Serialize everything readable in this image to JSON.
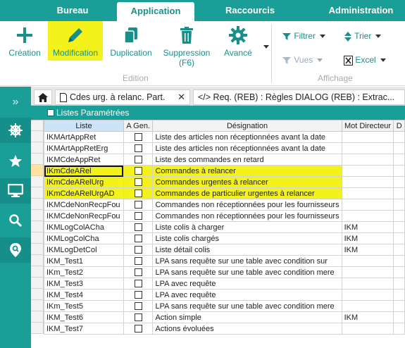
{
  "menu": {
    "tabs": [
      "Bureau",
      "Application",
      "Raccourcis",
      "Administration"
    ],
    "active": "Application"
  },
  "ribbon": {
    "creation": "Création",
    "modification": "Modification",
    "duplication": "Duplication",
    "suppression": "Suppression",
    "suppression_key": "(F6)",
    "avance": "Avancé",
    "group_edition": "Edition",
    "filtrer": "Filtrer",
    "trier": "Trier",
    "vues": "Vues",
    "excel": "Excel",
    "group_affichage": "Affichage"
  },
  "doc_tabs": {
    "tab1": "Cdes urg. à relanc. Part.",
    "tab2": "</> Req. (REB) : Règles DIALOG (REB) : Extrac..."
  },
  "panel": {
    "title": "Listes Paramétrées"
  },
  "grid": {
    "headers": [
      "Liste",
      "A Gen.",
      "Désignation",
      "Mot Directeur",
      "D"
    ],
    "rows": [
      {
        "liste": "IKMArtAppRet",
        "designation": "Liste des articles non réceptionnées avant la date",
        "mot": ""
      },
      {
        "liste": "IKMArtAppRetErg",
        "designation": "Liste des articles non réceptionnées avant la date",
        "mot": ""
      },
      {
        "liste": "IKMCdeAppRet",
        "designation": "Liste des commandes en retard",
        "mot": ""
      },
      {
        "liste": "IKmCdeARel",
        "designation": "Commandes à relancer",
        "mot": ""
      },
      {
        "liste": "IKmCdeARelUrg",
        "designation": "Commandes urgentes à relancer",
        "mot": ""
      },
      {
        "liste": "IKmCdeARelUrgAD",
        "designation": "Commandes de particulier urgentes à relancer",
        "mot": ""
      },
      {
        "liste": "IKMCdeNonRecpFou",
        "designation": "Commandes non réceptionnées pour les fournisseurs",
        "mot": ""
      },
      {
        "liste": "IKMCdeNonRecpFou",
        "designation": "Commandes non réceptionnées pour les fournisseurs",
        "mot": ""
      },
      {
        "liste": "IKMLogColACha",
        "designation": "Liste colis à charger",
        "mot": "IKM"
      },
      {
        "liste": "IKMLogColCha",
        "designation": "Liste colis chargés",
        "mot": "IKM"
      },
      {
        "liste": "IKMLogDetCol",
        "designation": "Liste détail colis",
        "mot": "IKM"
      },
      {
        "liste": "IKM_Test1",
        "designation": "LPA sans requête sur une table avec condition sur",
        "mot": ""
      },
      {
        "liste": "IKm_Test2",
        "designation": "LPA sans requête sur une table avec condition mere",
        "mot": ""
      },
      {
        "liste": "IKM_Test3",
        "designation": "LPA avec requête",
        "mot": ""
      },
      {
        "liste": "IKM_Test4",
        "designation": "LPA avec requête",
        "mot": ""
      },
      {
        "liste": "IKm_Test5",
        "designation": "LPA sans requête sur une table avec condition mere",
        "mot": ""
      },
      {
        "liste": "IKM_Test6",
        "designation": "Action simple",
        "mot": "IKM"
      },
      {
        "liste": "IKM_Test7",
        "designation": "Actions évoluées",
        "mot": ""
      }
    ]
  },
  "colors": {
    "teal": "#1a9e98",
    "highlight": "#f3f31b"
  }
}
